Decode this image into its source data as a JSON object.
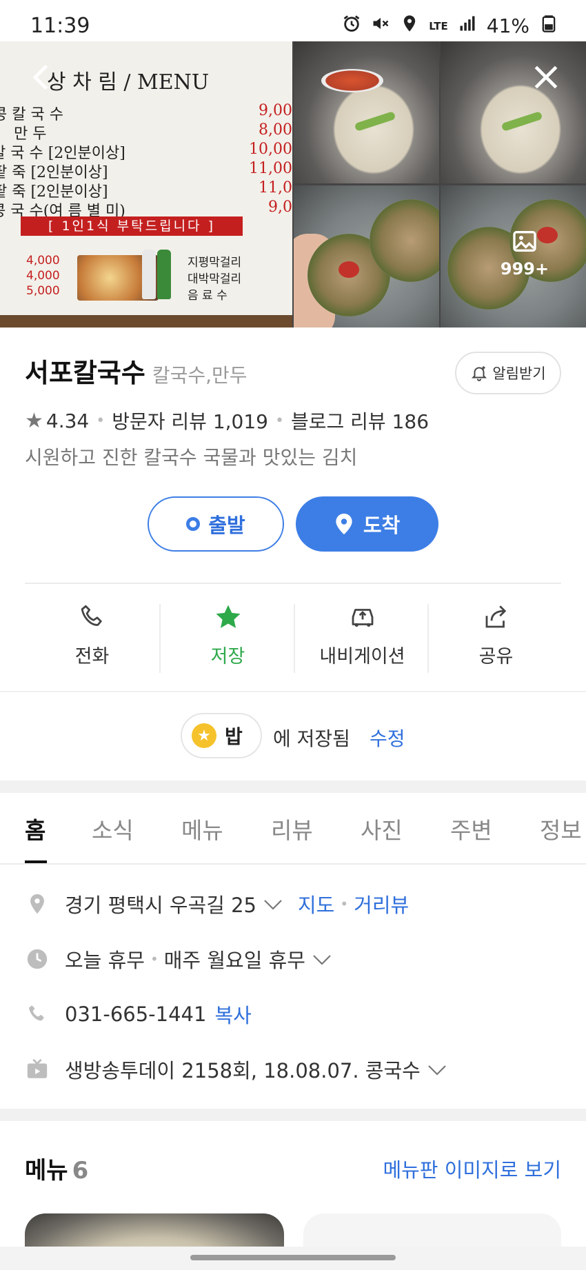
{
  "status_bar": {
    "time": "11:39",
    "battery": "41%",
    "network": "LTE",
    "icons": [
      "alarm-icon",
      "mute-icon",
      "location-icon",
      "lte-icon",
      "signal-icon",
      "battery-icon"
    ]
  },
  "photos": {
    "menu_board": {
      "title": "상 차 림 / MENU",
      "rows": [
        {
          "name": "콩 칼 국 수",
          "price": "9,00"
        },
        {
          "name": "만     두",
          "price": "8,00"
        },
        {
          "name": "칼  국  수 [2인분이상]",
          "price": "10,00"
        },
        {
          "name": "팥     죽 [2인분이상]",
          "price": "11,00"
        },
        {
          "name": "팥     죽 [2인분이상]",
          "price": "11,0"
        },
        {
          "name": "콩  국  수(여 름 별 미)",
          "price": "9,0"
        }
      ],
      "banner": "[ 1인1식 부탁드립니다 ]",
      "lower_prices": [
        "4,000",
        "4,000",
        "5,000"
      ],
      "lower_items": [
        "지평막걸리",
        "대박막걸리",
        "음  료  수"
      ]
    },
    "more_count": "999+",
    "back_icon": "back-arrow-icon",
    "close_icon": "close-icon"
  },
  "place": {
    "name": "서포칼국수",
    "category": "칼국수,만두",
    "notify_label": "알림받기",
    "rating": "4.34",
    "visitor_reviews": "방문자 리뷰 1,019",
    "blog_reviews": "블로그 리뷰 186",
    "description": "시원하고 진한 칼국수 국물과 맛있는 김치"
  },
  "route": {
    "depart_label": "출발",
    "arrive_label": "도착"
  },
  "actions": [
    {
      "label": "전화",
      "icon": "phone-icon"
    },
    {
      "label": "저장",
      "icon": "star-icon"
    },
    {
      "label": "내비게이션",
      "icon": "car-icon"
    },
    {
      "label": "공유",
      "icon": "share-icon"
    }
  ],
  "saved": {
    "folder": "밥",
    "text": "에 저장됨",
    "edit": "수정"
  },
  "tabs": [
    "홈",
    "소식",
    "메뉴",
    "리뷰",
    "사진",
    "주변",
    "정보"
  ],
  "info": {
    "address": "경기 평택시 우곡길 25",
    "map_link": "지도",
    "streetview_link": "거리뷰",
    "hours_today": "오늘 휴무",
    "hours_weekly": "매주 월요일 휴무",
    "phone": "031-665-1441",
    "copy_label": "복사",
    "tv": "생방송투데이 2158회, 18.08.07. 콩국수"
  },
  "menu_section": {
    "title": "메뉴",
    "count": "6",
    "board_link": "메뉴판 이미지로 보기"
  },
  "colors": {
    "accent_blue": "#3d7ee6",
    "saved_green": "#2ea94a",
    "coin_yellow": "#f5c22c",
    "menu_red": "#c41f1f"
  }
}
